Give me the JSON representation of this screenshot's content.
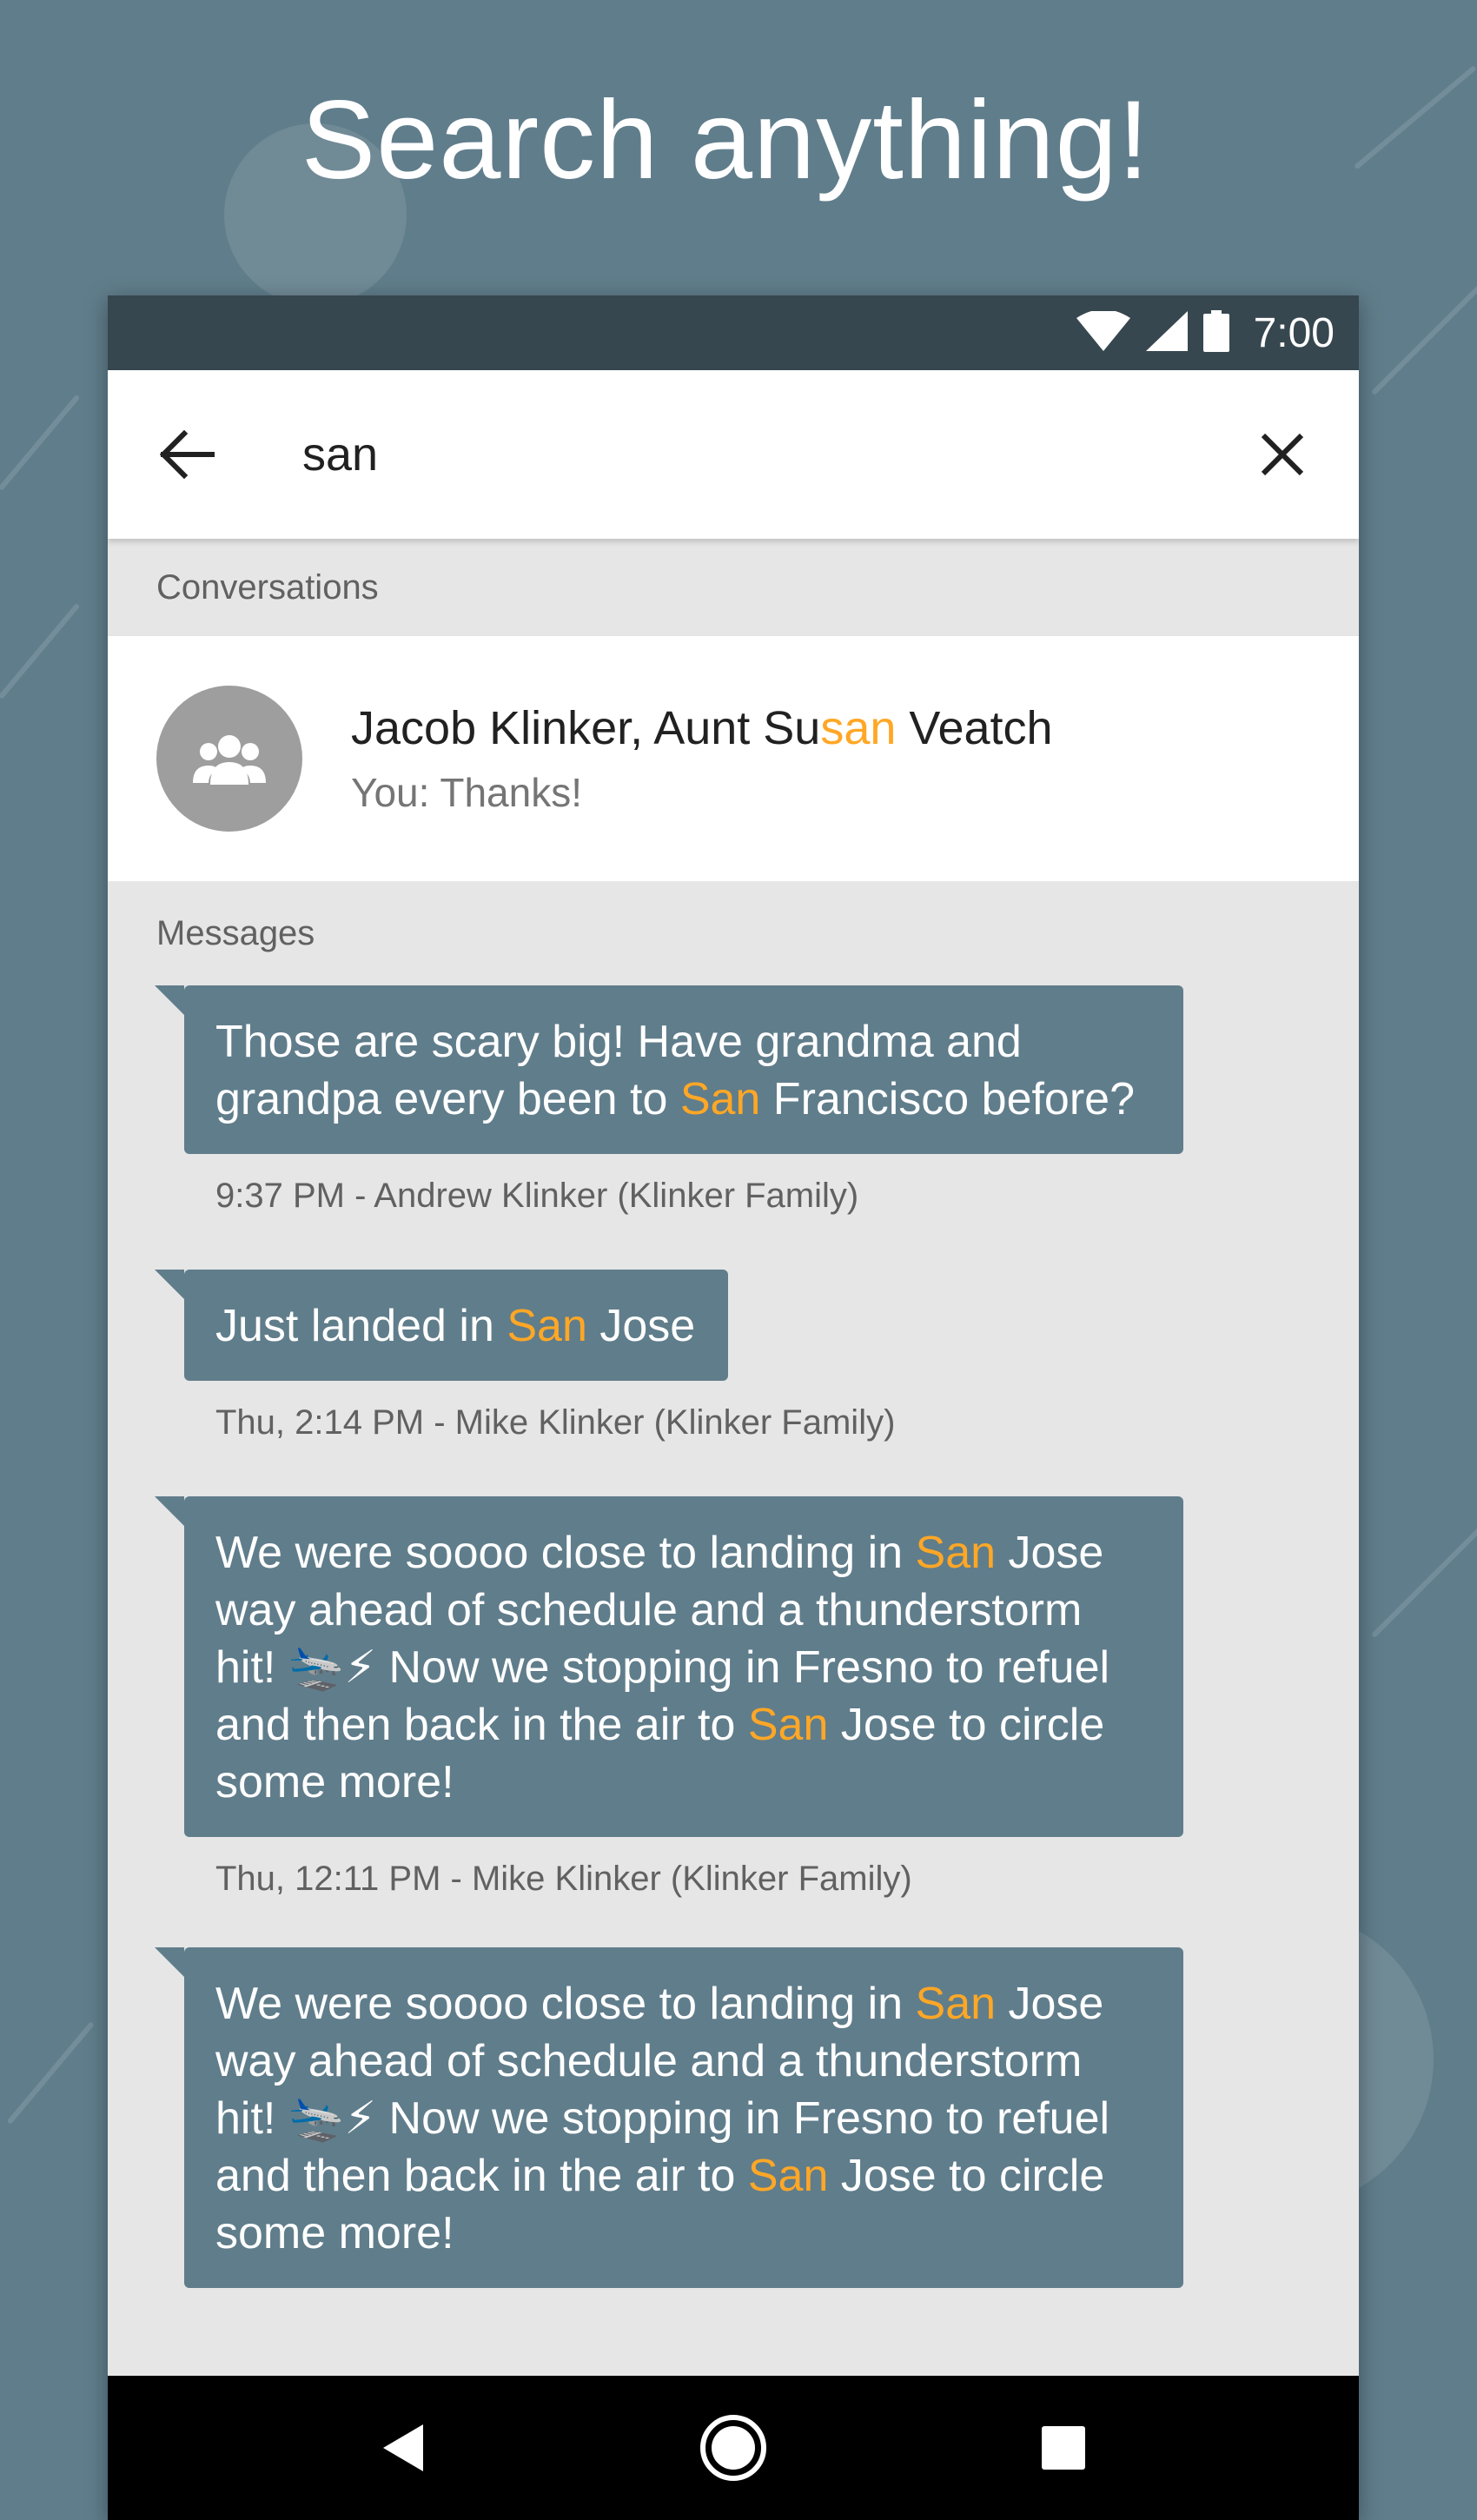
{
  "headline": "Search anything!",
  "status_bar": {
    "time": "7:00",
    "icons": [
      "wifi-icon",
      "signal-icon",
      "battery-icon"
    ]
  },
  "search": {
    "query": "san",
    "back_icon": "arrow-left-icon",
    "clear_icon": "close-icon"
  },
  "sections": {
    "conversations": "Conversations",
    "messages": "Messages"
  },
  "conversation": {
    "title_parts": [
      "Jacob Klinker, Aunt Su",
      "san",
      " Veatch"
    ],
    "snippet": "You: Thanks!",
    "avatar_icon": "group-icon"
  },
  "messages": [
    {
      "parts": [
        "Those are scary big! Have grandma and grandpa every been to ",
        "San",
        " Francisco before?"
      ],
      "meta": "9:37 PM - Andrew Klinker (Klinker Family)"
    },
    {
      "parts": [
        "Just landed in ",
        "San",
        " Jose"
      ],
      "meta": "Thu, 2:14 PM - Mike Klinker (Klinker Family)"
    },
    {
      "parts": [
        "We were soooo close to landing in ",
        "San",
        " Jose way ahead of schedule and a thunderstorm hit! 🛬⚡ Now we stopping in Fresno to refuel and then back in the air to ",
        "San",
        " Jose to circle some more!"
      ],
      "meta": "Thu, 12:11 PM - Mike Klinker (Klinker Family)"
    },
    {
      "parts": [
        "We were soooo close to landing in ",
        "San",
        " Jose way ahead of schedule and a thunderstorm hit! 🛬⚡ Now we stopping in Fresno to refuel and then back in the air to ",
        "San",
        " Jose to circle some more!"
      ],
      "meta": ""
    }
  ],
  "nav_bar": {
    "icons": [
      "back-triangle-icon",
      "home-circle-icon",
      "recents-square-icon"
    ]
  },
  "colors": {
    "background": "#607d8b",
    "highlight": "#ffa726",
    "status_bar": "#37474f",
    "bubble": "#607d8b"
  }
}
